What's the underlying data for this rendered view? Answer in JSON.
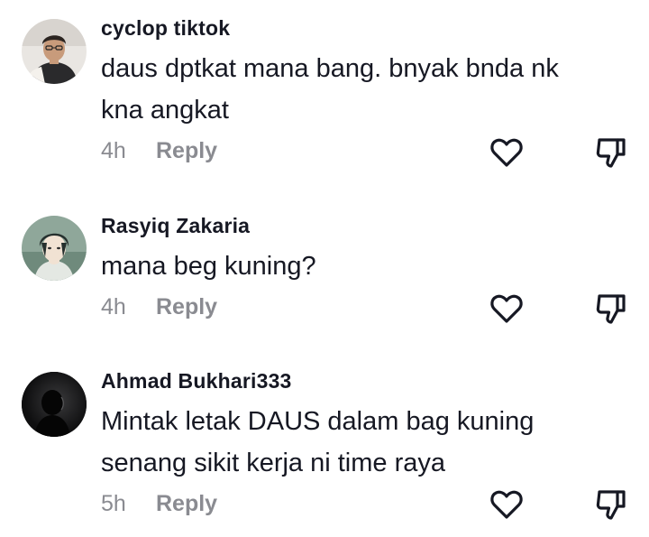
{
  "comments": [
    {
      "username": "cyclop tiktok",
      "text": "daus dptkat mana bang. bnyak bnda nk kna angkat",
      "time": "4h",
      "reply_label": "Reply",
      "avatar_icon": "user-photo-avatar",
      "like_icon": "heart-icon",
      "dislike_icon": "thumbs-down-icon"
    },
    {
      "username": "Rasyiq Zakaria",
      "text": "mana beg kuning?",
      "time": "4h",
      "reply_label": "Reply",
      "avatar_icon": "anime-character-avatar",
      "like_icon": "heart-icon",
      "dislike_icon": "thumbs-down-icon"
    },
    {
      "username": "Ahmad Bukhari333",
      "text": "Mintak letak DAUS dalam bag kuning senang sikit kerja ni time raya",
      "time": "5h",
      "reply_label": "Reply",
      "avatar_icon": "silhouette-avatar",
      "like_icon": "heart-icon",
      "dislike_icon": "thumbs-down-icon"
    }
  ],
  "colors": {
    "primary_text": "#161823",
    "secondary_text": "#8a8b91",
    "icon": "#161823",
    "background": "#ffffff"
  }
}
